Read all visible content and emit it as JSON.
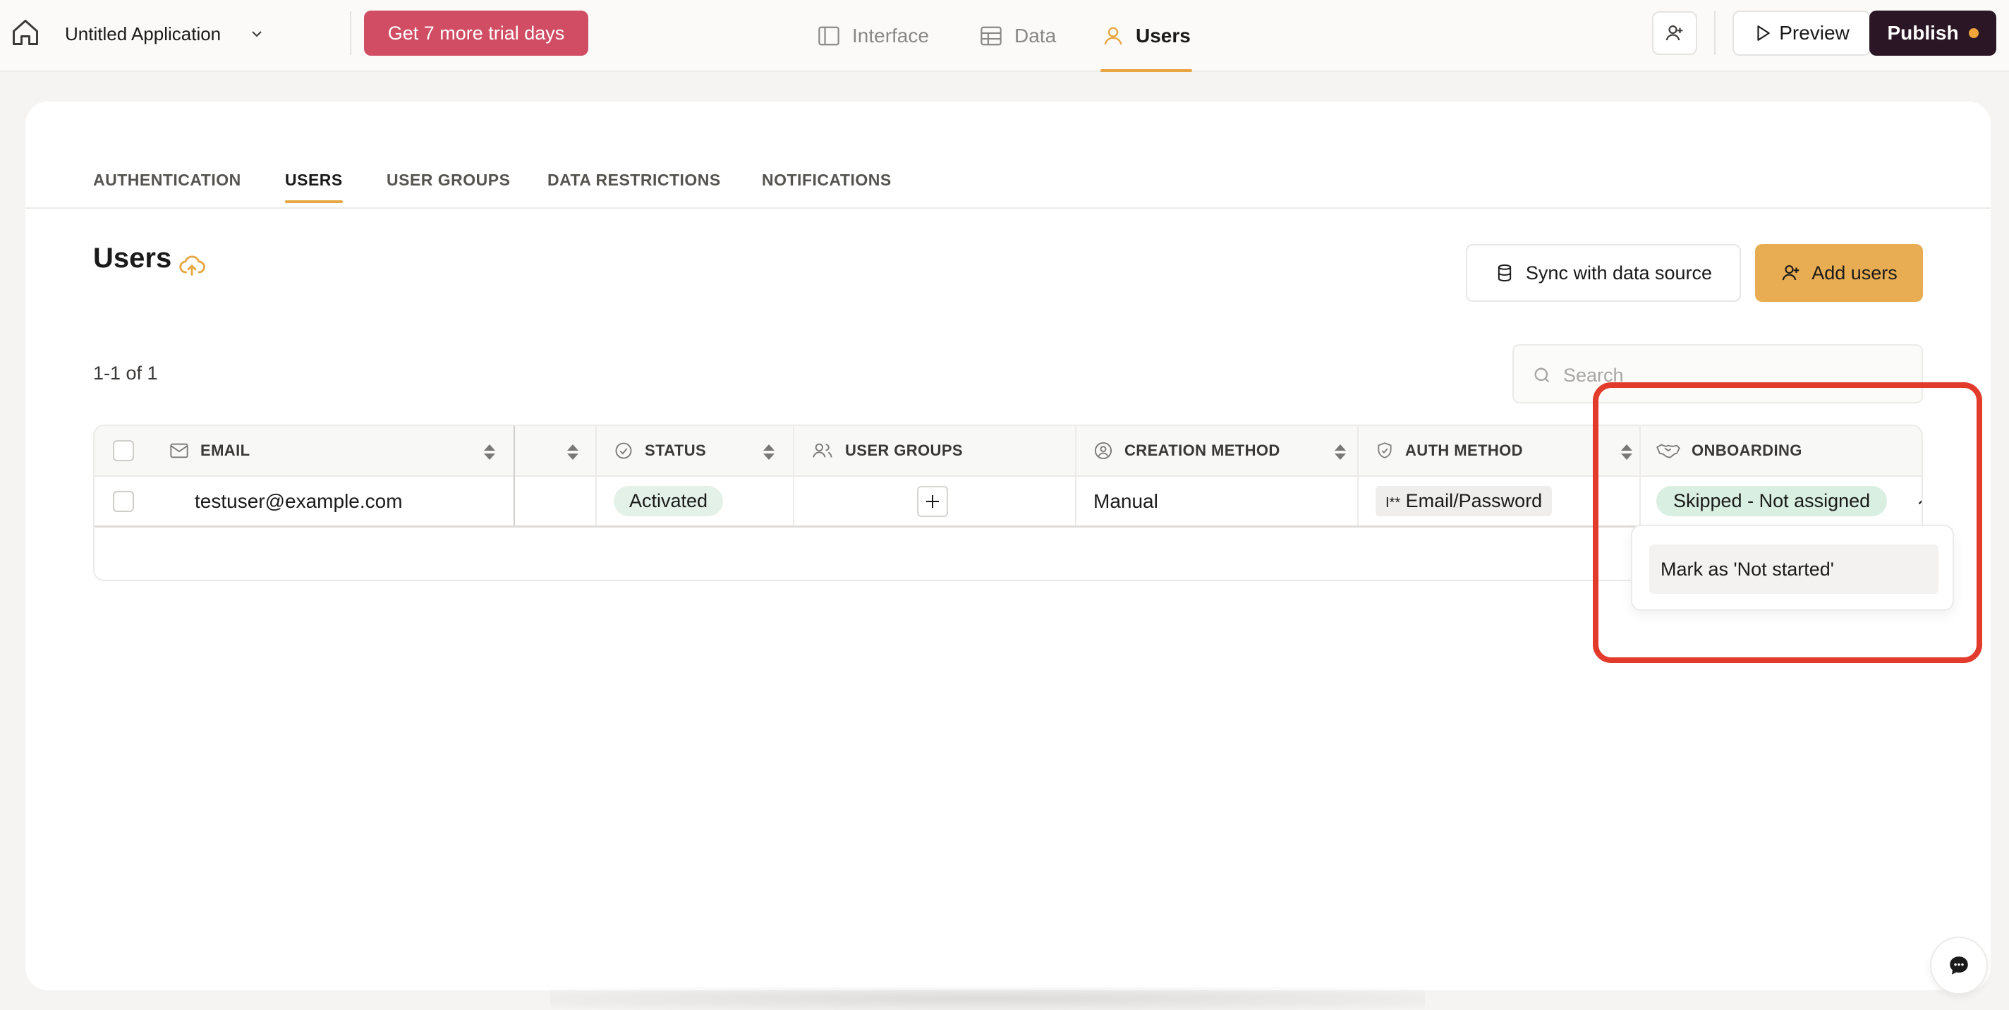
{
  "app": {
    "name": "Untitled Application"
  },
  "trial": {
    "label": "Get 7 more trial days"
  },
  "nav": {
    "tabs": [
      {
        "label": "Interface",
        "icon": "layout-icon"
      },
      {
        "label": "Data",
        "icon": "table-icon"
      },
      {
        "label": "Users",
        "icon": "user-icon",
        "active": true
      }
    ]
  },
  "actions": {
    "preview": "Preview",
    "publish": "Publish"
  },
  "subtabs": [
    {
      "label": "AUTHENTICATION"
    },
    {
      "label": "USERS",
      "active": true
    },
    {
      "label": "USER GROUPS"
    },
    {
      "label": "DATA RESTRICTIONS"
    },
    {
      "label": "NOTIFICATIONS"
    }
  ],
  "users": {
    "title": "Users",
    "sync_label": "Sync with data source",
    "add_label": "Add users",
    "count": "1-1 of 1",
    "search_placeholder": "Search"
  },
  "table": {
    "columns": {
      "email": "EMAIL",
      "status": "STATUS",
      "user_groups": "USER GROUPS",
      "creation_method": "CREATION METHOD",
      "auth_method": "AUTH METHOD",
      "onboarding": "ONBOARDING"
    },
    "rows": [
      {
        "email": "testuser@example.com",
        "status": "Activated",
        "creation_method": "Manual",
        "auth_prefix": "I**",
        "auth_method": "Email/Password",
        "onboarding": "Skipped - Not assigned"
      }
    ]
  },
  "dropdown": {
    "item": "Mark as 'Not started'"
  },
  "colors": {
    "accent": "#e8a643",
    "trial": "#d04d64",
    "publish": "#2a1624",
    "add_users": "#e8ad52",
    "highlight": "#e23b2c",
    "status_badge": "#e3f1e8"
  }
}
